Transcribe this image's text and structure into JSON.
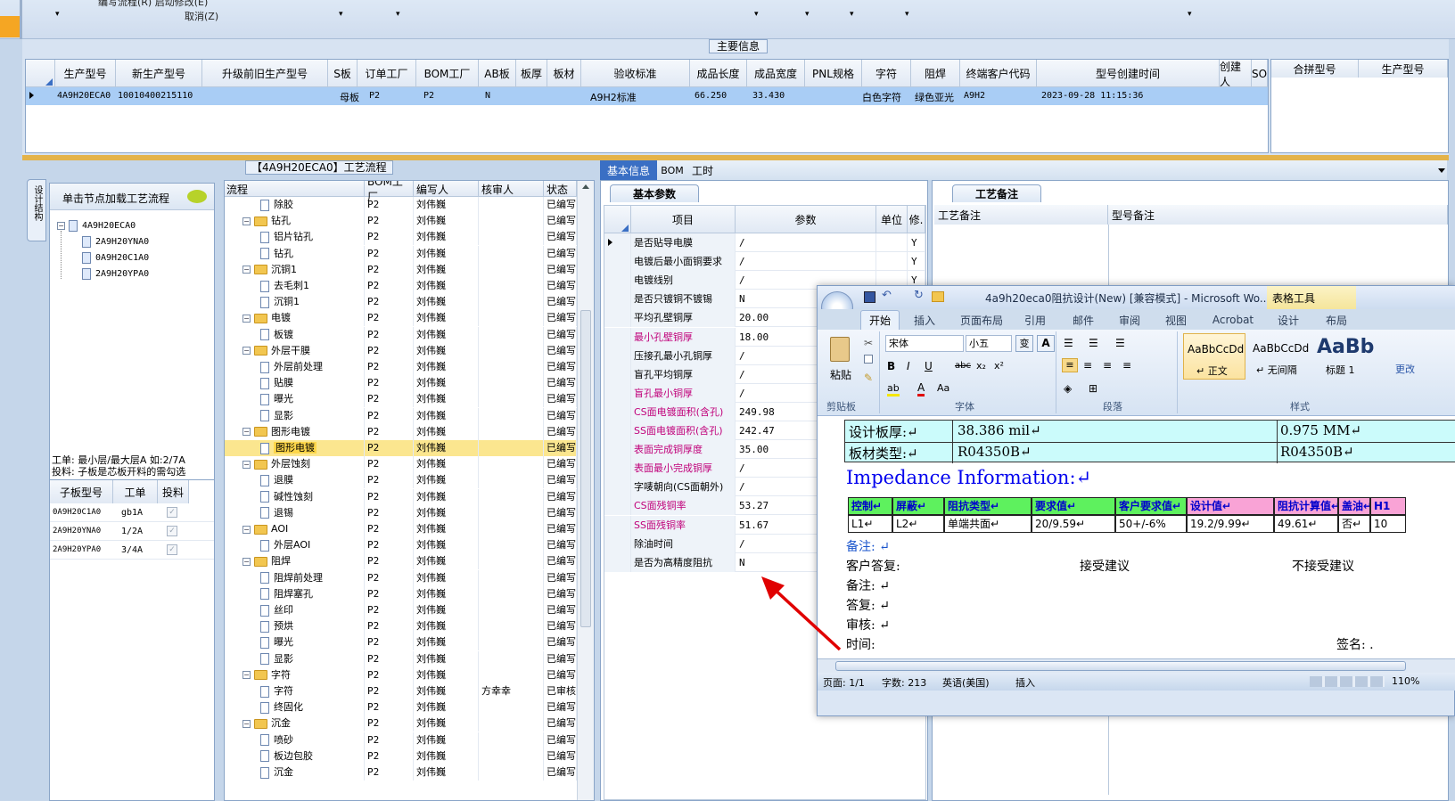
{
  "top_toolbar": {
    "menu_line1": "编写流程(R)    启动修改(E)",
    "menu_line2": "取消(Z)",
    "dropdowns": [
      "▾",
      "▾",
      "▾",
      "▾",
      "▾",
      "▾",
      "▾",
      "▾",
      "▾"
    ]
  },
  "main_info": {
    "title": "主要信息",
    "columns": [
      "生产型号",
      "新生产型号",
      "升级前旧生产型号",
      "S板",
      "订单工厂",
      "BOM工厂",
      "AB板",
      "板厚",
      "板材",
      "验收标准",
      "成品长度",
      "成品宽度",
      "PNL规格",
      "字符",
      "阻焊",
      "终端客户代码",
      "型号创建时间",
      "创建人",
      "SO"
    ],
    "row": {
      "生产型号": "4A9H20ECA0",
      "新生产型号": "10010400215110",
      "S板": "母板",
      "订单工厂": "P2",
      "BOM工厂": "P2",
      "AB板": "N",
      "验收标准": "A9H2标准",
      "成品长度": "66.250",
      "成品宽度": "33.430",
      "字符": "白色字符",
      "阻焊": "绿色亚光",
      "终端客户代码": "A9H2",
      "型号创建时间": "2023-09-28 11:15:36"
    },
    "merge_columns": [
      "合拼型号",
      "生产型号"
    ]
  },
  "left_panel": {
    "vtab": "设计结构",
    "load_hint": "单击节点加载工艺流程",
    "tree_root": "4A9H20ECA0",
    "tree_children": [
      "2A9H20YNA0",
      "0A9H20C1A0",
      "2A9H20YPA0"
    ],
    "note_line1": "工单: 最小层/最大层A 如:2/7A",
    "note_line2": "投料: 子板是芯板开料的需勾选",
    "sub_columns": [
      "子板型号",
      "工单",
      "投料"
    ],
    "sub_rows": [
      {
        "model": "0A9H20C1A0",
        "order": "gb1A",
        "check": "✓"
      },
      {
        "model": "2A9H20YNA0",
        "order": "1/2A",
        "check": "✓"
      },
      {
        "model": "2A9H20YPA0",
        "order": "3/4A",
        "check": "✓"
      }
    ]
  },
  "process_flow": {
    "title": "【4A9H20ECA0】工艺流程",
    "columns": [
      "流程",
      "BOM工厂",
      "编写人",
      "核审人",
      "状态"
    ],
    "rows": [
      {
        "kind": "doc",
        "name": "除胶",
        "factory": "P2",
        "writer": "刘伟巍",
        "reviewer": "",
        "status": "已编写"
      },
      {
        "kind": "folder",
        "name": "钻孔",
        "factory": "P2",
        "writer": "刘伟巍",
        "reviewer": "",
        "status": "已编写"
      },
      {
        "kind": "doc",
        "name": "铝片钻孔",
        "factory": "P2",
        "writer": "刘伟巍",
        "reviewer": "",
        "status": "已编写"
      },
      {
        "kind": "doc",
        "name": "钻孔",
        "factory": "P2",
        "writer": "刘伟巍",
        "reviewer": "",
        "status": "已编写"
      },
      {
        "kind": "folder",
        "name": "沉铜1",
        "factory": "P2",
        "writer": "刘伟巍",
        "reviewer": "",
        "status": "已编写"
      },
      {
        "kind": "doc",
        "name": "去毛刺1",
        "factory": "P2",
        "writer": "刘伟巍",
        "reviewer": "",
        "status": "已编写"
      },
      {
        "kind": "doc",
        "name": "沉铜1",
        "factory": "P2",
        "writer": "刘伟巍",
        "reviewer": "",
        "status": "已编写"
      },
      {
        "kind": "folder",
        "name": "电镀",
        "factory": "P2",
        "writer": "刘伟巍",
        "reviewer": "",
        "status": "已编写"
      },
      {
        "kind": "doc",
        "name": "板镀",
        "factory": "P2",
        "writer": "刘伟巍",
        "reviewer": "",
        "status": "已编写"
      },
      {
        "kind": "folder",
        "name": "外层干膜",
        "factory": "P2",
        "writer": "刘伟巍",
        "reviewer": "",
        "status": "已编写"
      },
      {
        "kind": "doc",
        "name": "外层前处理",
        "factory": "P2",
        "writer": "刘伟巍",
        "reviewer": "",
        "status": "已编写"
      },
      {
        "kind": "doc",
        "name": "贴膜",
        "factory": "P2",
        "writer": "刘伟巍",
        "reviewer": "",
        "status": "已编写"
      },
      {
        "kind": "doc",
        "name": "曝光",
        "factory": "P2",
        "writer": "刘伟巍",
        "reviewer": "",
        "status": "已编写"
      },
      {
        "kind": "doc",
        "name": "显影",
        "factory": "P2",
        "writer": "刘伟巍",
        "reviewer": "",
        "status": "已编写"
      },
      {
        "kind": "folder",
        "name": "图形电镀",
        "factory": "P2",
        "writer": "刘伟巍",
        "reviewer": "",
        "status": "已编写"
      },
      {
        "kind": "doc",
        "name": "图形电镀",
        "factory": "P2",
        "writer": "刘伟巍",
        "reviewer": "",
        "status": "已编写",
        "selected": true
      },
      {
        "kind": "folder",
        "name": "外层蚀刻",
        "factory": "P2",
        "writer": "刘伟巍",
        "reviewer": "",
        "status": "已编写"
      },
      {
        "kind": "doc",
        "name": "退膜",
        "factory": "P2",
        "writer": "刘伟巍",
        "reviewer": "",
        "status": "已编写"
      },
      {
        "kind": "doc",
        "name": "碱性蚀刻",
        "factory": "P2",
        "writer": "刘伟巍",
        "reviewer": "",
        "status": "已编写"
      },
      {
        "kind": "doc",
        "name": "退锡",
        "factory": "P2",
        "writer": "刘伟巍",
        "reviewer": "",
        "status": "已编写"
      },
      {
        "kind": "folder",
        "name": "AOI",
        "factory": "P2",
        "writer": "刘伟巍",
        "reviewer": "",
        "status": "已编写"
      },
      {
        "kind": "doc",
        "name": "外层AOI",
        "factory": "P2",
        "writer": "刘伟巍",
        "reviewer": "",
        "status": "已编写"
      },
      {
        "kind": "folder",
        "name": "阻焊",
        "factory": "P2",
        "writer": "刘伟巍",
        "reviewer": "",
        "status": "已编写"
      },
      {
        "kind": "doc",
        "name": "阻焊前处理",
        "factory": "P2",
        "writer": "刘伟巍",
        "reviewer": "",
        "status": "已编写"
      },
      {
        "kind": "doc",
        "name": "阻焊塞孔",
        "factory": "P2",
        "writer": "刘伟巍",
        "reviewer": "",
        "status": "已编写"
      },
      {
        "kind": "doc",
        "name": "丝印",
        "factory": "P2",
        "writer": "刘伟巍",
        "reviewer": "",
        "status": "已编写"
      },
      {
        "kind": "doc",
        "name": "预烘",
        "factory": "P2",
        "writer": "刘伟巍",
        "reviewer": "",
        "status": "已编写"
      },
      {
        "kind": "doc",
        "name": "曝光",
        "factory": "P2",
        "writer": "刘伟巍",
        "reviewer": "",
        "status": "已编写"
      },
      {
        "kind": "doc",
        "name": "显影",
        "factory": "P2",
        "writer": "刘伟巍",
        "reviewer": "",
        "status": "已编写"
      },
      {
        "kind": "folder",
        "name": "字符",
        "factory": "P2",
        "writer": "刘伟巍",
        "reviewer": "",
        "status": "已编写"
      },
      {
        "kind": "doc",
        "name": "字符",
        "factory": "P2",
        "writer": "刘伟巍",
        "reviewer": "方幸幸",
        "status": "已审核"
      },
      {
        "kind": "doc",
        "name": "终固化",
        "factory": "P2",
        "writer": "刘伟巍",
        "reviewer": "",
        "status": "已编写"
      },
      {
        "kind": "folder",
        "name": "沉金",
        "factory": "P2",
        "writer": "刘伟巍",
        "reviewer": "",
        "status": "已编写"
      },
      {
        "kind": "doc",
        "name": "喷砂",
        "factory": "P2",
        "writer": "刘伟巍",
        "reviewer": "",
        "status": "已编写"
      },
      {
        "kind": "doc",
        "name": "板边包胶",
        "factory": "P2",
        "writer": "刘伟巍",
        "reviewer": "",
        "status": "已编写"
      },
      {
        "kind": "doc",
        "name": "沉金",
        "factory": "P2",
        "writer": "刘伟巍",
        "reviewer": "",
        "status": "已编写"
      }
    ]
  },
  "detail": {
    "tabs": [
      "基本信息",
      "BOM",
      "工时"
    ],
    "basic_tab": "基本参数",
    "columns": [
      "项目",
      "参数",
      "单位",
      "修."
    ],
    "params": [
      {
        "item": "是否贴导电膜",
        "value": "/",
        "flag": "Y",
        "red": false
      },
      {
        "item": "电镀后最小面铜要求",
        "value": "/",
        "flag": "Y",
        "red": false
      },
      {
        "item": "电镀线别",
        "value": "/",
        "flag": "Y",
        "red": false
      },
      {
        "item": "是否只镀铜不镀锡",
        "value": "N",
        "flag": "",
        "red": false
      },
      {
        "item": "平均孔壁铜厚",
        "value": "20.00",
        "flag": "",
        "red": false
      },
      {
        "item": "最小孔壁铜厚",
        "value": "18.00",
        "flag": "",
        "red": true
      },
      {
        "item": "压接孔最小孔铜厚",
        "value": "/",
        "flag": "",
        "red": false
      },
      {
        "item": "盲孔平均铜厚",
        "value": "/",
        "flag": "",
        "red": false
      },
      {
        "item": "盲孔最小铜厚",
        "value": "/",
        "flag": "",
        "red": true
      },
      {
        "item": "CS面电镀面积(含孔)",
        "value": "249.98",
        "flag": "",
        "red": true
      },
      {
        "item": "SS面电镀面积(含孔)",
        "value": "242.47",
        "flag": "",
        "red": true
      },
      {
        "item": "表面完成铜厚度",
        "value": "35.00",
        "flag": "",
        "red": true
      },
      {
        "item": "表面最小完成铜厚",
        "value": "/",
        "flag": "",
        "red": true
      },
      {
        "item": "字唛朝向(CS面朝外)",
        "value": "/",
        "flag": "",
        "red": false
      },
      {
        "item": "CS面残铜率",
        "value": "53.27",
        "flag": "",
        "red": true
      },
      {
        "item": "SS面残铜率",
        "value": "51.67",
        "flag": "",
        "red": true
      },
      {
        "item": "除油时间",
        "value": "/",
        "flag": "",
        "red": false
      },
      {
        "item": "是否为高精度阻抗",
        "value": "N",
        "flag": "",
        "red": false
      }
    ],
    "remark_tab": "工艺备注",
    "remark_columns": [
      "工艺备注",
      "型号备注"
    ]
  },
  "word": {
    "title": "4a9h20eca0阻抗设计(New) [兼容模式] - Microsoft Wo...",
    "context_tab": "表格工具",
    "tabs": [
      "开始",
      "插入",
      "页面布局",
      "引用",
      "邮件",
      "审阅",
      "视图",
      "Acrobat",
      "设计",
      "布局"
    ],
    "font_name": "宋体",
    "font_size": "小五",
    "groups": [
      "剪贴板",
      "字体",
      "段落",
      "样式"
    ],
    "paste": "粘贴",
    "styles": [
      {
        "sample": "AaBbCcDd",
        "name": "↵ 正文"
      },
      {
        "sample": "AaBbCcDd",
        "name": "↵ 无间隔"
      },
      {
        "sample": "AaBb",
        "name": "标题 1"
      }
    ],
    "more_label": "更改",
    "doc": {
      "row1_label": "设计板厚:↵",
      "row1_v1": "38.386 mil↵",
      "row1_v2": "0.975 MM↵",
      "row2_label": "板材类型:↵",
      "row2_v1": "R04350B↵",
      "row2_v2": "R04350B↵",
      "heading": "Impedance Information:↵",
      "imp_headers": [
        "控制↵",
        "屏蔽↵",
        "阻抗类型↵",
        "要求值↵",
        "客户要求值↵",
        "设计值↵",
        "阻抗计算值↵",
        "盖油↵",
        "H1"
      ],
      "imp_row": [
        "L1↵",
        "L2↵",
        "单端共面↵",
        "20/9.59↵",
        "50+/-6%",
        "19.2/9.99↵",
        "49.61↵",
        "否↵",
        "10"
      ],
      "notes1": "备注: ↵",
      "reply_label": "客户答复:",
      "accept": "接受建议",
      "reject": "不接受建议",
      "notes2": "备注: ↵",
      "answer": "答复: ↵",
      "review": "审核: ↵",
      "time": "时间:",
      "sign": "签名: ."
    },
    "status": [
      "页面: 1/1",
      "字数: 213",
      "英语(美国)",
      "插入"
    ],
    "zoom": "110%"
  },
  "colors": {
    "accent_blue": "#3a6fc4",
    "selection": "#a9cdf5",
    "annotation_arrow": "#e00000",
    "red_text": "#c0007a"
  }
}
